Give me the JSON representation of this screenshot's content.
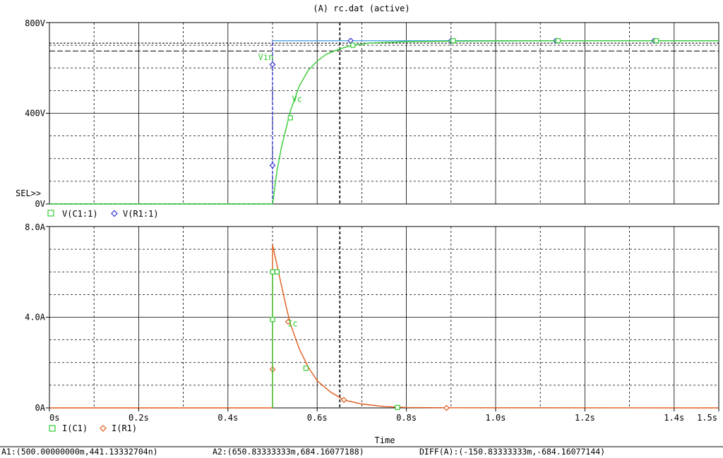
{
  "window": {
    "title": "(A) rc.dat (active)"
  },
  "status_bar": {
    "a1": "A1:(500.00000000m,441.13332704n)",
    "a2": "A2:(650.83333333m,684.16077188)",
    "diff": "DIFF(A):(-150.83333333m,-684.16077144)"
  },
  "sel_marker": "SEL>>",
  "colors": {
    "vc": "#33cc33",
    "vin": "#3333cc",
    "vin_high": "#4da6e6",
    "current_r1": "#e05a1a",
    "current_c1": "#33cc33",
    "grid": "#000000"
  },
  "chart_data": [
    {
      "type": "line",
      "name": "voltage-plot",
      "ylim": [
        0,
        800
      ],
      "xlim": [
        0,
        1.5
      ],
      "ytick_labels": [
        "800V",
        "400V",
        "0V"
      ],
      "yticks": [
        800,
        400,
        0
      ],
      "legend": [
        {
          "name": "V(C1:1)",
          "marker": "square"
        },
        {
          "name": "V(R1:1)",
          "marker": "diamond"
        }
      ],
      "annotations": [
        {
          "text": "Vin",
          "x": 0.485,
          "y": 635
        },
        {
          "text": "Vc",
          "x": 0.555,
          "y": 450
        }
      ],
      "cursor_levels": [
        700,
        684.16
      ],
      "cursor_x": [
        0.5,
        0.6508
      ],
      "series": [
        {
          "name": "V(R1:1)",
          "x": [
            0,
            0.5,
            0.5,
            0.5,
            1.5
          ],
          "y": [
            0,
            0,
            160,
            620,
            720
          ],
          "markers_x": [
            0.5,
            0.5,
            0.675,
            0.9,
            1.135,
            1.355
          ],
          "markers_y": [
            170,
            615,
            720,
            720,
            720,
            720
          ]
        },
        {
          "name": "V(C1:1)",
          "x": [
            0,
            0.5,
            0.51,
            0.52,
            0.54,
            0.56,
            0.58,
            0.6,
            0.62,
            0.65,
            0.68,
            0.72,
            0.8,
            0.9,
            1.0,
            1.2,
            1.5
          ],
          "y": [
            0,
            0,
            145,
            250,
            410,
            520,
            590,
            630,
            660,
            684,
            700,
            710,
            716,
            718,
            719,
            720,
            720
          ],
          "markers_x": [
            0.54,
            0.68,
            0.905,
            1.14,
            1.36
          ],
          "markers_y": [
            380,
            700,
            720,
            720,
            720
          ]
        }
      ]
    },
    {
      "type": "line",
      "name": "current-plot",
      "ylim": [
        0,
        8
      ],
      "xlim": [
        0,
        1.5
      ],
      "ytick_labels": [
        "8.0A",
        "4.0A",
        "0A"
      ],
      "yticks": [
        8,
        4,
        0
      ],
      "xtick_labels": [
        "0s",
        "0.2s",
        "0.4s",
        "0.6s",
        "0.8s",
        "1.0s",
        "1.2s",
        "1.4s",
        "1.5s"
      ],
      "xticks": [
        0,
        0.2,
        0.4,
        0.6,
        0.8,
        1.0,
        1.2,
        1.4,
        1.5
      ],
      "xlabel": "Time",
      "legend": [
        {
          "name": "I(C1)",
          "marker": "square"
        },
        {
          "name": "I(R1)",
          "marker": "diamond"
        }
      ],
      "annotations": [
        {
          "text": "Ic",
          "x": 0.545,
          "y": 3.6
        }
      ],
      "cursor_x": [
        0.5,
        0.6508
      ],
      "series": [
        {
          "name": "I(R1)",
          "x": [
            0,
            0.5,
            0.5,
            0.51,
            0.52,
            0.53,
            0.54,
            0.56,
            0.58,
            0.6,
            0.63,
            0.66,
            0.7,
            0.75,
            0.8,
            0.9,
            1.5
          ],
          "y": [
            0,
            0,
            7.2,
            6.3,
            5.4,
            4.5,
            3.7,
            2.6,
            1.8,
            1.2,
            0.7,
            0.35,
            0.17,
            0.06,
            0.02,
            0.005,
            0
          ],
          "markers_x": [
            0.5,
            0.535,
            0.66,
            0.89
          ],
          "markers_y": [
            1.7,
            3.8,
            0.35,
            0.0
          ]
        },
        {
          "name": "I(C1)",
          "x": [
            0.5,
            0.5
          ],
          "y": [
            0,
            6.0
          ],
          "markers_x": [
            0.5,
            0.51,
            0.5,
            0.575,
            0.78
          ],
          "markers_y": [
            3.9,
            6.0,
            6.0,
            1.75,
            0.02
          ]
        }
      ]
    }
  ]
}
